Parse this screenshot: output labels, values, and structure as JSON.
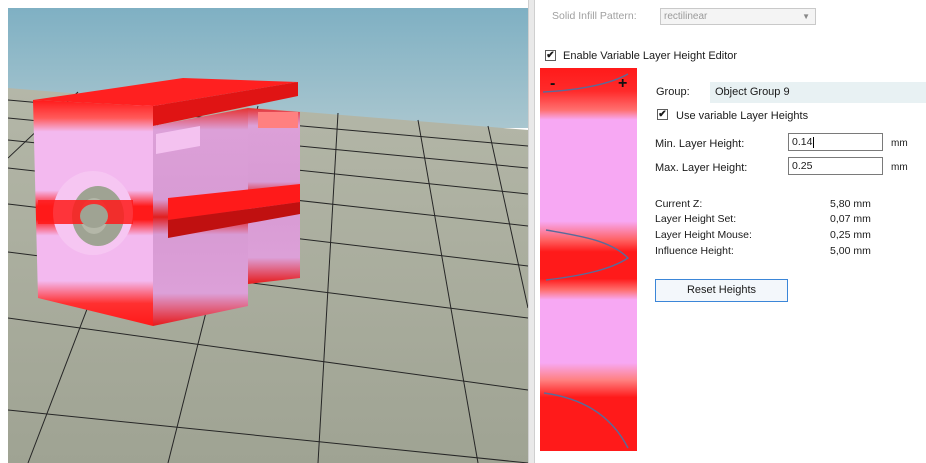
{
  "panel": {
    "solid_infill_label": "Solid Infill Pattern:",
    "solid_infill_value": "rectilinear",
    "enable_editor_label": "Enable Variable Layer Height Editor",
    "enable_editor_checked": true,
    "strip_minus": "-",
    "strip_plus": "+",
    "group_label": "Group:",
    "group_value": "Object Group 9",
    "use_variable_label": "Use variable Layer Heights",
    "use_variable_checked": true,
    "min_label": "Min. Layer Height:",
    "min_value": "0.14",
    "min_unit": "mm",
    "max_label": "Max. Layer Height:",
    "max_value": "0.25",
    "max_unit": "mm",
    "stats": [
      {
        "label": "Current Z:",
        "value": "5,80 mm"
      },
      {
        "label": "Layer Height Set:",
        "value": "0,07 mm"
      },
      {
        "label": "Layer Height Mouse:",
        "value": "0,25 mm"
      },
      {
        "label": "Influence Height:",
        "value": "5,00 mm"
      }
    ],
    "reset_label": "Reset Heights"
  },
  "colors": {
    "sky": "#8fb8c6",
    "ground": "#a7aa9c",
    "fine_layer": "#ff1a1a",
    "coarse_layer": "#f4a6f0",
    "accent_border": "#3b86d8"
  }
}
